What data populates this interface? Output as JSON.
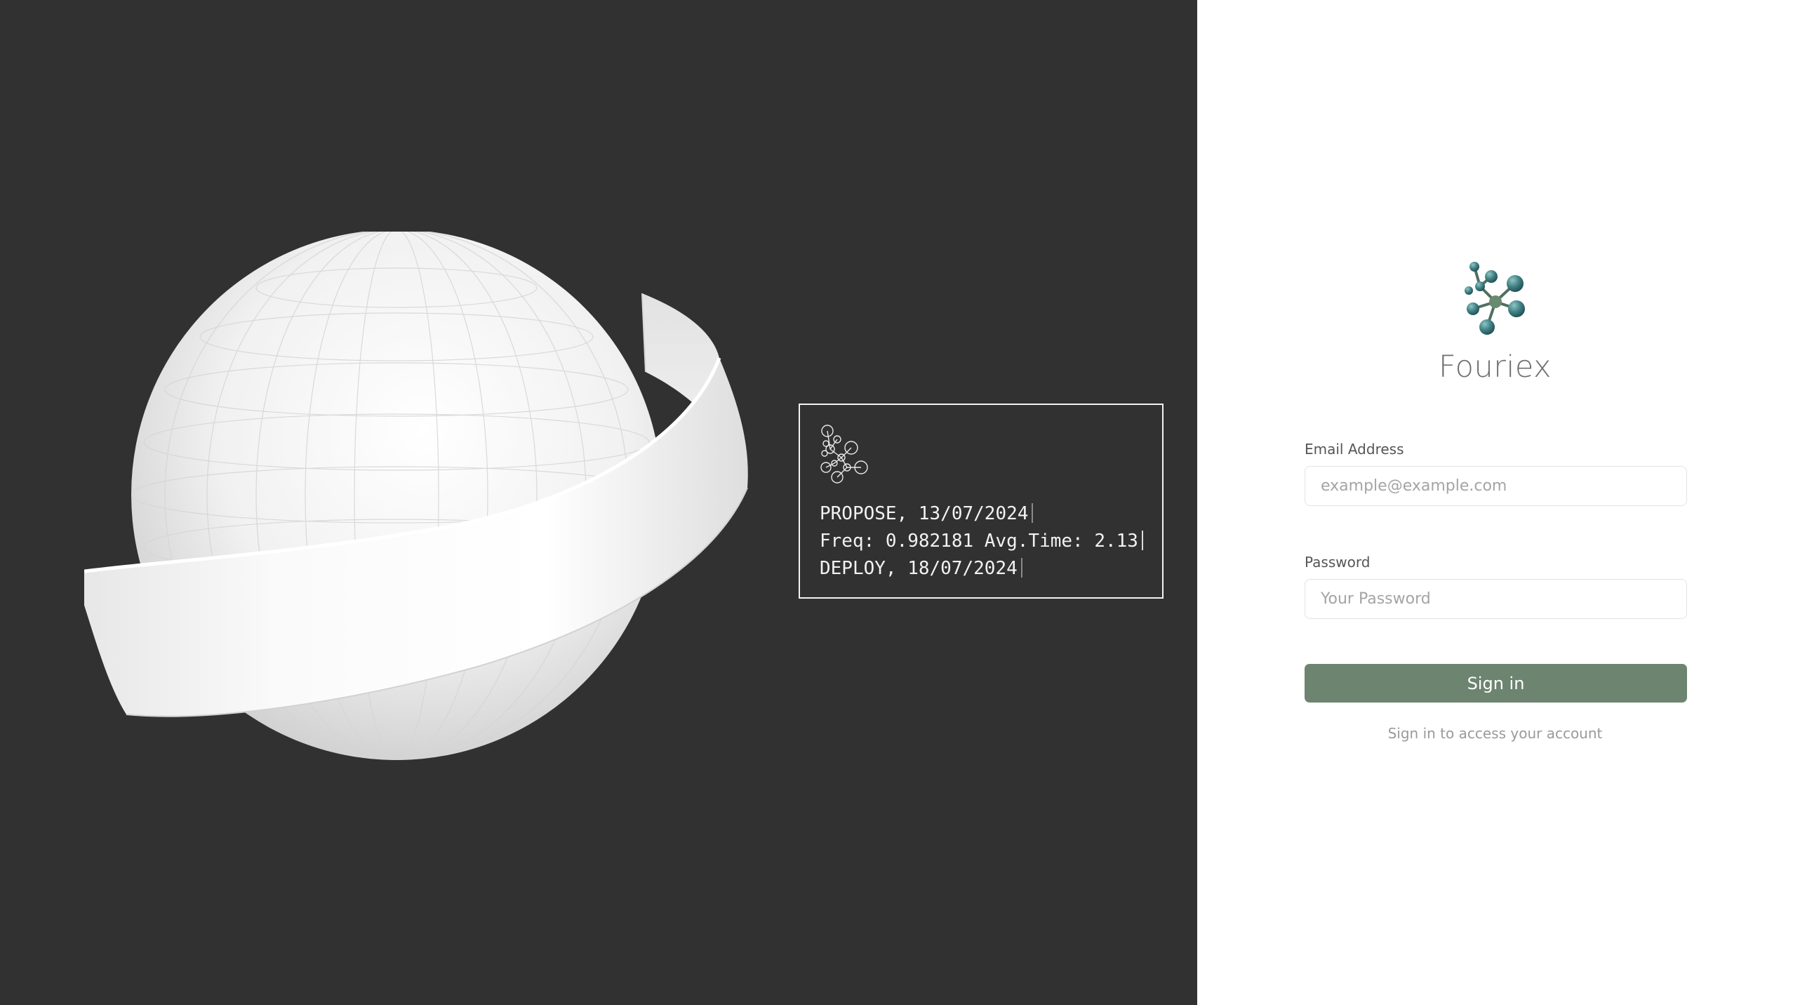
{
  "hero": {
    "image_name": "white-sphere-with-ribbon"
  },
  "terminal": {
    "logo_icon": "molecule-outline-icon",
    "lines": [
      "PROPOSE, 13/07/2024",
      "Freq: 0.982181 Avg.Time: 2.13",
      "DEPLOY, 18/07/2024"
    ]
  },
  "brand": {
    "name": "Fouriex",
    "logo_icon": "molecule-logo-icon"
  },
  "form": {
    "email_label": "Email Address",
    "email_placeholder": "example@example.com",
    "password_label": "Password",
    "password_placeholder": "Your Password",
    "signin_label": "Sign in",
    "helper_text": "Sign in to access your account"
  },
  "colors": {
    "left_background": "#313131",
    "button": "#6d8470",
    "logo_teal": "#3e7f83"
  }
}
